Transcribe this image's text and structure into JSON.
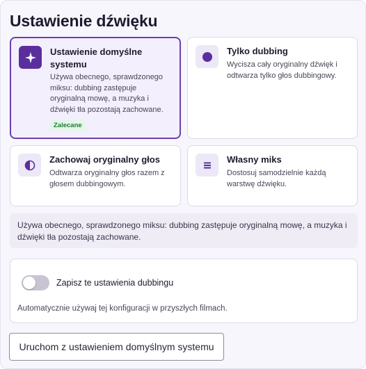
{
  "title": "Ustawienie dźwięku",
  "options": [
    {
      "title": "Ustawienie domyślne systemu",
      "description": "Używa obecnego, sprawdzonego miksu: dubbing zastępuje oryginalną mowę, a muzyka i dźwięki tła pozostają zachowane.",
      "badge": "Zalecane",
      "icon": "sparkle-icon",
      "selected": true
    },
    {
      "title": "Tylko dubbing",
      "description": "Wycisza cały oryginalny dźwięk i odtwarza tylko głos dubbingowy.",
      "icon": "circle-dot-icon",
      "selected": false
    },
    {
      "title": "Zachowaj oryginalny głos",
      "description": "Odtwarza oryginalny głos razem z głosem dubbingowym.",
      "icon": "half-circle-icon",
      "selected": false
    },
    {
      "title": "Własny miks",
      "description": "Dostosuj samodzielnie każdą warstwę dźwięku.",
      "icon": "equalizer-lines-icon",
      "selected": false
    }
  ],
  "info_text": "Używa obecnego, sprawdzonego miksu: dubbing zastępuje oryginalną mowę, a muzyka i dźwięki tła pozostają zachowane.",
  "save": {
    "toggle_label": "Zapisz te ustawienia dubbingu",
    "toggle_on": false,
    "description": "Automatycznie używaj tej konfiguracji w przyszłych filmach."
  },
  "launch_button_label": "Uruchom z ustawieniem domyślnym systemu",
  "colors": {
    "accent": "#6b3fb0",
    "accent_dark": "#5b2e9e",
    "badge_bg": "#e4f6e8",
    "badge_text": "#1f7a35"
  }
}
